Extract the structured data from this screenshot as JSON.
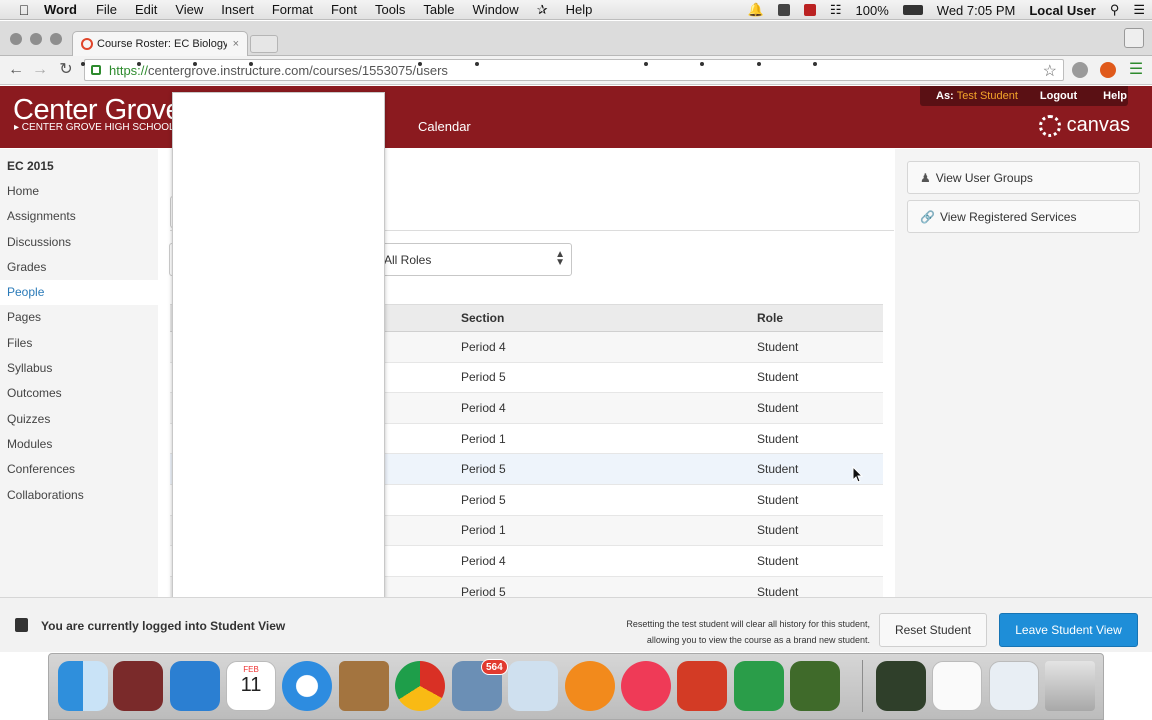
{
  "menubar": {
    "apple": "",
    "app": "Word",
    "items": [
      "File",
      "Edit",
      "View",
      "Insert",
      "Format",
      "Font",
      "Tools",
      "Table",
      "Window",
      "Help"
    ],
    "battery": "100%",
    "clock": "Wed 7:05 PM",
    "user": "Local User"
  },
  "browser": {
    "tab_title": "Course Roster: EC Biology",
    "tab_close": "×",
    "url_scheme": "https://",
    "url_rest": "centergrove.instructure.com/courses/1553075/users",
    "back": "←",
    "forward": "→",
    "reload": "↻",
    "star": "☆"
  },
  "header": {
    "logo": "Center Grove",
    "logo_sub": "▸ CENTER GROVE HIGH SCHOOL",
    "nav_partial": "s",
    "nav_calendar": "Calendar",
    "as_label": "As:",
    "as_user": "Test Student",
    "logout": "Logout",
    "help": "Help",
    "canvas_brand": "canvas"
  },
  "sidebar": {
    "course": "EC 2015",
    "items": [
      "Home",
      "Assignments",
      "Discussions",
      "Grades",
      "People",
      "Pages",
      "Files",
      "Syllabus",
      "Outcomes",
      "Quizzes",
      "Modules",
      "Conferences",
      "Collaborations"
    ],
    "active": "People"
  },
  "filters": {
    "role_select": "All Roles"
  },
  "table": {
    "headers": [
      "",
      "Section",
      "Role"
    ],
    "rows": [
      [
        "Period 4",
        "Student"
      ],
      [
        "Period 5",
        "Student"
      ],
      [
        "Period 4",
        "Student"
      ],
      [
        "Period 1",
        "Student"
      ],
      [
        "Period 5",
        "Student"
      ],
      [
        "Period 5",
        "Student"
      ],
      [
        "Period 1",
        "Student"
      ],
      [
        "Period 4",
        "Student"
      ],
      [
        "Period 5",
        "Student"
      ]
    ]
  },
  "right": {
    "user_groups": "View User Groups",
    "registered_services": "View Registered Services"
  },
  "student_view": {
    "message": "You are currently logged into Student View",
    "note_line1": "Resetting the test student will clear all history for this student,",
    "note_line2": "allowing you to view the course as a brand new student.",
    "reset": "Reset Student",
    "leave": "Leave Student View"
  },
  "dock": {
    "badge_count": "564",
    "calendar_month": "FEB",
    "calendar_day": "11"
  }
}
